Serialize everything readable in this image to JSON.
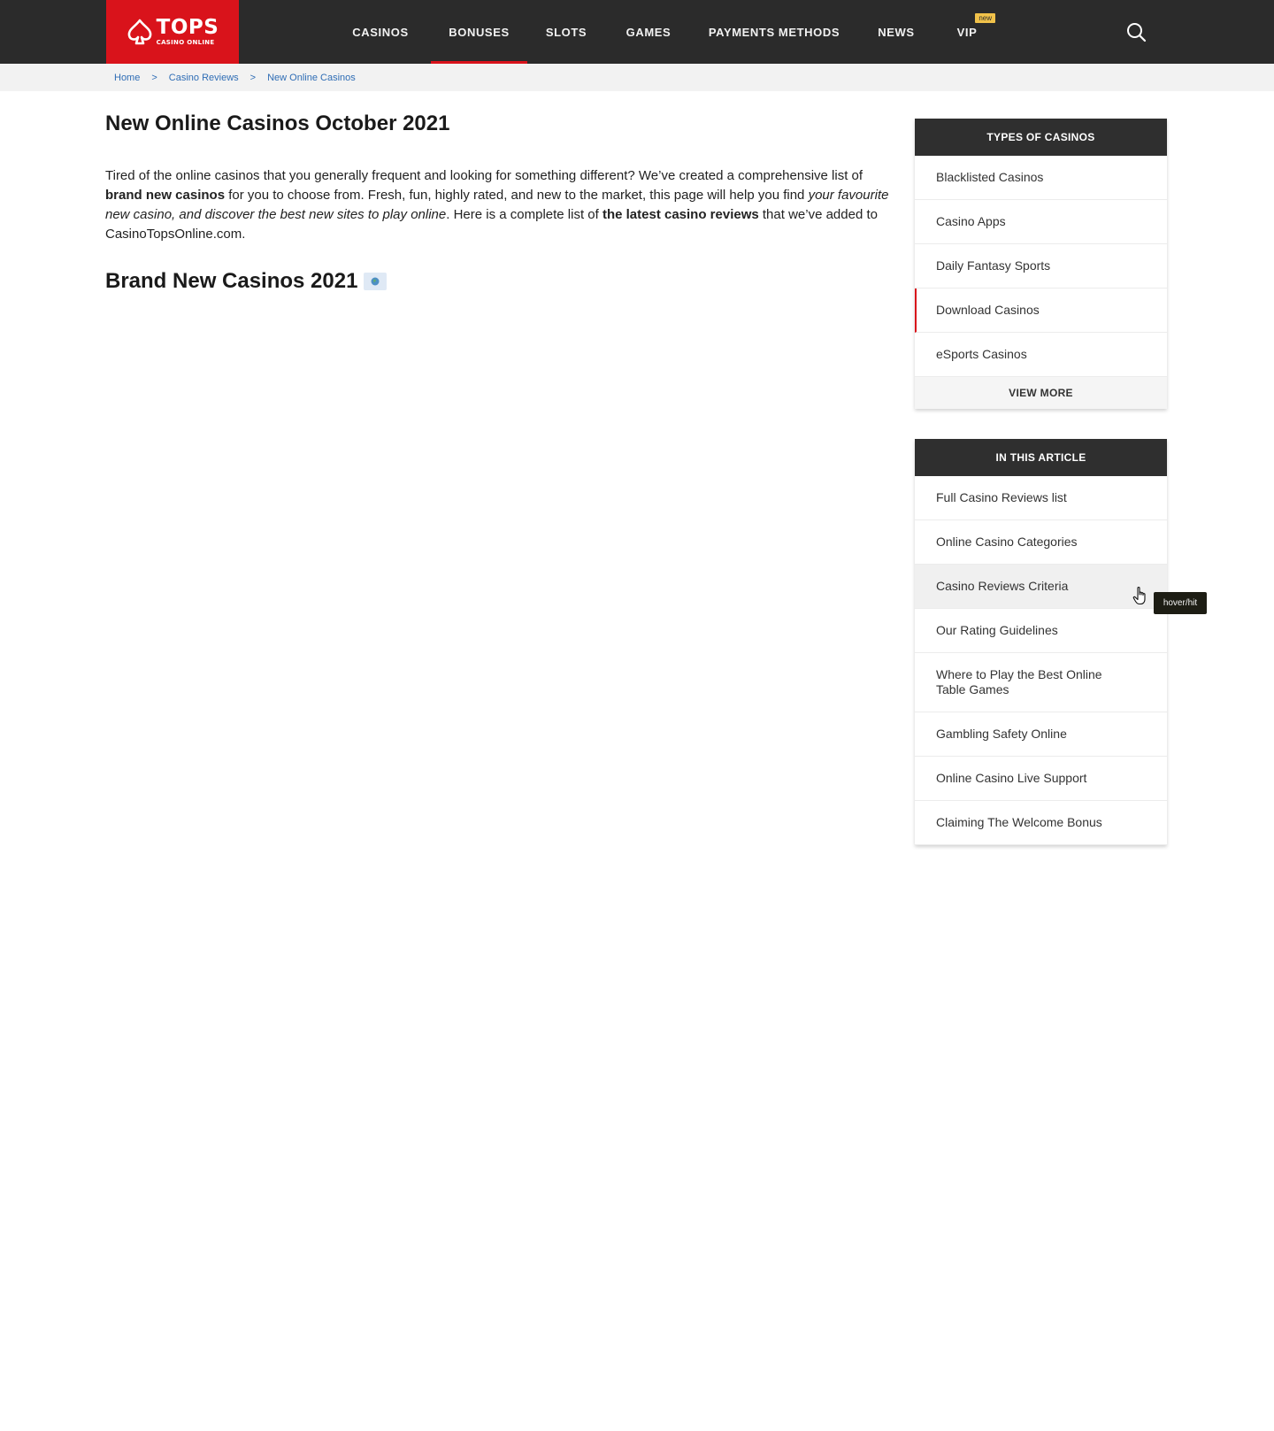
{
  "brand": {
    "word": "TOPS",
    "sub": "CASINO ONLINE",
    "color": "#d9131b"
  },
  "nav": {
    "items": [
      "CASINOS",
      "BONUSES",
      "SLOTS",
      "GAMES",
      "PAYMENTS METHODS",
      "NEWS",
      "VIP"
    ],
    "active": "BONUSES",
    "vip_badge": "new"
  },
  "icons": {
    "search": "search-icon",
    "globe": "globe-icon",
    "cursor": "hand-pointer-icon",
    "logo": "spade-icon"
  },
  "breadcrumb": {
    "items": [
      "Home",
      "Casino Reviews",
      "New Online Casinos"
    ],
    "separator": ">"
  },
  "main": {
    "title": "New Online Casinos October 2021",
    "intro": {
      "p1": "Tired of the online casinos that you generally frequent and looking for something different? We’ve created a comprehensive list of ",
      "b1": "brand new casinos",
      "p2": " for you to choose from. Fresh, fun, highly rated, and new to the market, this page will help you find ",
      "i1": "your favourite new casino, and discover the best new sites to play online",
      "p3": ". Here is a complete list of ",
      "b2": "the latest casino reviews",
      "p4": " that we’ve added to CasinoTopsOnline.com."
    },
    "section_title": "Brand New Casinos 2021"
  },
  "sidebar": {
    "types": {
      "heading": "TYPES OF CASINOS",
      "items": [
        "Blacklisted Casinos",
        "Casino Apps",
        "Daily Fantasy Sports",
        "Download Casinos",
        "eSports Casinos"
      ],
      "more": "VIEW MORE"
    },
    "article": {
      "heading": "IN THIS ARTICLE",
      "items": [
        "Full Casino Reviews list",
        "Online Casino Categories",
        "Casino Reviews Criteria",
        "Our Rating Guidelines",
        "Where to Play the Best Online Table Games",
        "Gambling Safety Online",
        "Online Casino Live Support",
        "Claiming The Welcome Bonus"
      ]
    }
  },
  "tooltip": "hover/hit"
}
